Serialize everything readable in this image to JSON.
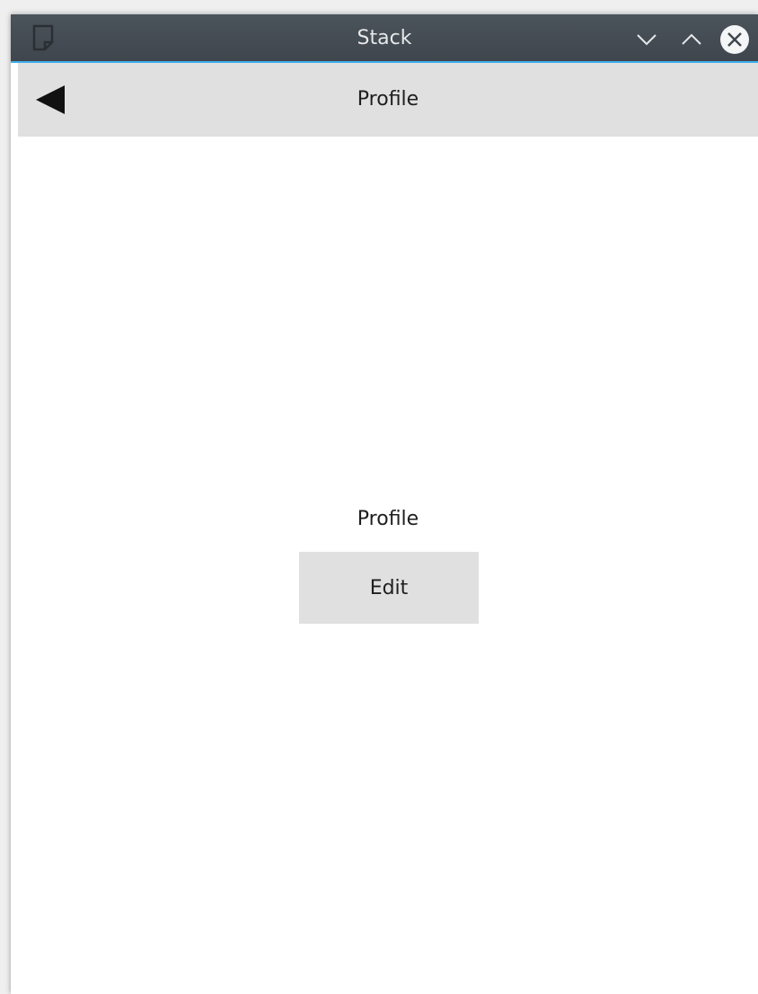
{
  "window": {
    "title": "Stack",
    "app_icon": "document-icon",
    "controls": {
      "minimize_icon": "chevron-down-icon",
      "maximize_icon": "chevron-up-icon",
      "close_icon": "close-circle-icon"
    },
    "accent_color": "#3daee9"
  },
  "toolbar": {
    "back_icon": "back-arrow-icon",
    "title": "Profile"
  },
  "page": {
    "label": "Profile",
    "edit_button_label": "Edit"
  }
}
